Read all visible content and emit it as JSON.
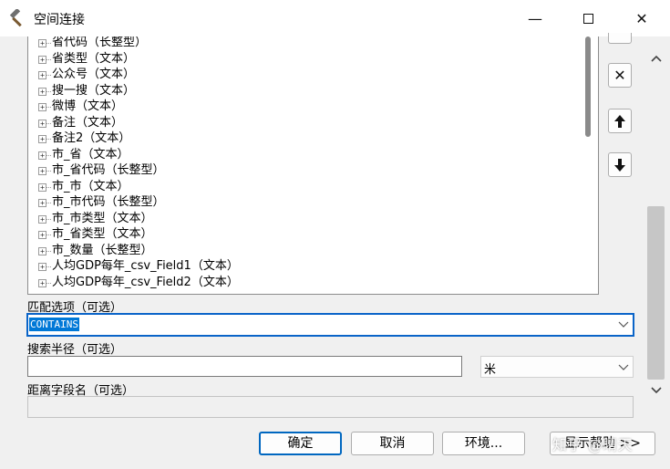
{
  "window": {
    "title": "空间连接",
    "minimize_glyph": "—",
    "close_glyph": "✕"
  },
  "field_list": {
    "items": [
      "省代码（长整型）",
      "省类型（文本）",
      "公众号（文本）",
      "搜一搜（文本）",
      "微博（文本）",
      "备注（文本）",
      "备注2（文本）",
      "市_省（文本）",
      "市_省代码（长整型）",
      "市_市（文本）",
      "市_市代码（长整型）",
      "市_市类型（文本）",
      "市_省类型（文本）",
      "市_数量（长整型）",
      "人均GDP每年_csv_Field1（文本）",
      "人均GDP每年_csv_Field2（文本）"
    ]
  },
  "side_buttons": {
    "remove_glyph": "✕",
    "up_glyph": "🡅",
    "down_glyph": "🡇"
  },
  "scrollbar": {
    "up_glyph": "⌃",
    "down_glyph": "⌄"
  },
  "match_option": {
    "label": "匹配选项（可选）",
    "value": "CONTAINS"
  },
  "search_radius": {
    "label": "搜索半径（可选）",
    "value": "",
    "unit": "米"
  },
  "distance_field": {
    "label": "距离字段名（可选）",
    "value": ""
  },
  "buttons": {
    "ok": "确定",
    "cancel": "取消",
    "environments": "环境...",
    "show_help": "显示帮助 >>"
  },
  "watermark": "知乎 @晴天"
}
